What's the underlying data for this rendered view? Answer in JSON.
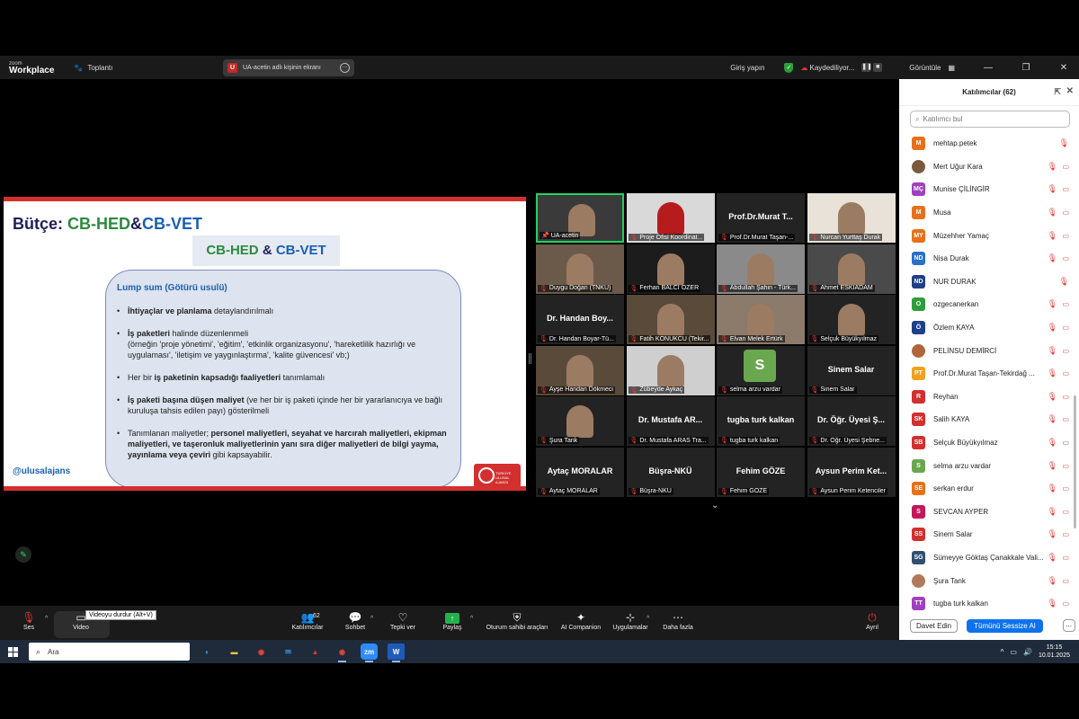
{
  "titlebar": {
    "brand_small": "zoom",
    "brand": "Workplace",
    "meeting_label": "Toplantı",
    "share_label": "UA-acetin adlı kişinin ekranı",
    "share_initial": "U",
    "signin": "Giriş yapın",
    "recording": "Kaydediliyor...",
    "view": "Görüntüle"
  },
  "slide": {
    "title_prefix": "Bütçe: ",
    "title_hed": "CB-HED",
    "title_amp": "&",
    "title_vet": "CB-VET",
    "banner_hed": "CB-HED",
    "banner_amp": " & ",
    "banner_vet": "CB-VET",
    "box_title": "Lump sum (Götürü usulü)",
    "b1_bold": "İhtiyaçlar ve planlama",
    "b1_rest": " detaylandırılmalı",
    "b2_bold": "İş paketleri",
    "b2_rest": " halinde düzenlenmeli",
    "b2_detail": "(örneğin 'proje yönetimi', 'eğitim', 'etkinlik organizasyonu', 'hareketlilik hazırlığı ve uygulaması', 'iletişim ve yaygınlaştırma', 'kalite güvencesi' vb;)",
    "b3_pre": "Her bir ",
    "b3_bold": "iş paketinin kapsadığı faaliyetleri",
    "b3_rest": " tanımlamalı",
    "b4_bold": "İş paketi başına düşen maliyet",
    "b4_rest": " (ve her bir iş paketi içinde her bir yararlanıcıya ve bağlı kuruluşa tahsis edilen payı) gösterilmeli",
    "b5_pre": "Tanımlanan maliyetler; ",
    "b5_bold": "personel maliyetleri, seyahat ve harcırah maliyetleri, ekipman maliyetleri, ve taşeronluk maliyetlerinin yanı sıra diğer maliyetleri de bilgi yayma, yayınlama veya çeviri",
    "b5_rest": " gibi kapsayabilir.",
    "tag": "@ulusalajans",
    "logo_text": "TÜRKİYE ULUSAL AJANSI"
  },
  "gallery": {
    "tiles": [
      {
        "label": "UA-acetin",
        "big": ""
      },
      {
        "label": "Proje Ofisi Koordinat...",
        "big": ""
      },
      {
        "label": "Prof.Dr.Murat Taşan-...",
        "big": "Prof.Dr.Murat T..."
      },
      {
        "label": "Nurcan Yurttaş Durak",
        "big": ""
      },
      {
        "label": "Duygu Doğan (TNKU)",
        "big": ""
      },
      {
        "label": "Ferhan BALCI ÖZER",
        "big": ""
      },
      {
        "label": "Abdullah Şahin - Türk...",
        "big": ""
      },
      {
        "label": "Ahmet ESKİADAM",
        "big": ""
      },
      {
        "label": "Dr. Handan Boyar-Tü...",
        "big": "Dr. Handan Boy..."
      },
      {
        "label": "Fatih KONUKCU (Tekir...",
        "big": ""
      },
      {
        "label": "Elvan Melek Ertürk",
        "big": ""
      },
      {
        "label": "Selçuk Büyükyılmaz",
        "big": ""
      },
      {
        "label": "Ayşe Handan Dökmeci",
        "big": ""
      },
      {
        "label": "Zübeyde Aykaç",
        "big": ""
      },
      {
        "label": "selma arzu vardar",
        "big": "S"
      },
      {
        "label": "Sinem Salar",
        "big": "Sinem Salar"
      },
      {
        "label": "Şura Tank",
        "big": ""
      },
      {
        "label": "Dr. Mustafa ARAS Tra...",
        "big": "Dr. Mustafa AR..."
      },
      {
        "label": "tugba turk kalkan",
        "big": "tugba turk kalkan"
      },
      {
        "label": "Dr. Öğr. Üyesi Şebne...",
        "big": "Dr. Öğr. Üyesi Ş..."
      },
      {
        "label": "Aytaç MORALAR",
        "big": "Aytaç MORALAR"
      },
      {
        "label": "Büşra-NKÜ",
        "big": "Büşra-NKÜ"
      },
      {
        "label": "Fehim GÖZE",
        "big": "Fehim GÖZE"
      },
      {
        "label": "Aysun Perim Ketenciler",
        "big": "Aysun Perim Ket..."
      }
    ]
  },
  "panel": {
    "title": "Katılımcılar (62)",
    "search_placeholder": "Katılımcı bul",
    "participants": [
      {
        "initials": "M",
        "name": "mehtap.petek",
        "color": "#e8701a",
        "cam": false
      },
      {
        "initials": "",
        "name": "Mert Uğur Kara",
        "color": "#7b5a3c",
        "cam": true
      },
      {
        "initials": "MÇ",
        "name": "Munise ÇİLİNGİR",
        "color": "#a040c0",
        "cam": true
      },
      {
        "initials": "M",
        "name": "Musa",
        "color": "#e8701a",
        "cam": true
      },
      {
        "initials": "MY",
        "name": "Müzehher Yamaç",
        "color": "#e8701a",
        "cam": true
      },
      {
        "initials": "ND",
        "name": "Nisa Durak",
        "color": "#2a6fc9",
        "cam": true
      },
      {
        "initials": "ND",
        "name": "NUR DURAK",
        "color": "#1e3f8a",
        "cam": false
      },
      {
        "initials": "O",
        "name": "ozgecanerkan",
        "color": "#2e9d3a",
        "cam": true
      },
      {
        "initials": "Ö",
        "name": "Özlem KAYA",
        "color": "#1e3f8a",
        "cam": true
      },
      {
        "initials": "",
        "name": "PELİNSU DEMİRCİ",
        "color": "#b0653a",
        "cam": true
      },
      {
        "initials": "PT",
        "name": "Prof.Dr.Murat Taşan-Tekirdağ ...",
        "color": "#f0a020",
        "cam": true
      },
      {
        "initials": "R",
        "name": "Reyhan",
        "color": "#d32f2f",
        "cam": true
      },
      {
        "initials": "SK",
        "name": "Salih KAYA",
        "color": "#d32f2f",
        "cam": true
      },
      {
        "initials": "SB",
        "name": "Selçuk Büyükyılmaz",
        "color": "#d32f2f",
        "cam": false,
        "mic_on": true
      },
      {
        "initials": "S",
        "name": "selma arzu vardar",
        "color": "#6aa84f",
        "cam": true
      },
      {
        "initials": "SE",
        "name": "serkan erdur",
        "color": "#e8701a",
        "cam": true
      },
      {
        "initials": "S",
        "name": "SEVCAN AYPER",
        "color": "#c2185b",
        "cam": true
      },
      {
        "initials": "SS",
        "name": "Sinem Salar",
        "color": "#d32f2f",
        "cam": true
      },
      {
        "initials": "SG",
        "name": "Sümeyye Göktaş Çanakkale Vali...",
        "color": "#2f4f6f",
        "cam": true
      },
      {
        "initials": "",
        "name": "Şura Tank",
        "color": "#b07a5a",
        "cam": true
      },
      {
        "initials": "TT",
        "name": "tugba turk kalkan",
        "color": "#a040c0",
        "cam": true
      }
    ],
    "invite": "Davet Edin",
    "mute_all": "Tümünü Sessize Al",
    "more": "..."
  },
  "toolbar": {
    "audio": "Ses",
    "video": "Video",
    "video_tooltip": "Videoyu durdur (Alt+V)",
    "participants": "Katılımcılar",
    "participants_count": "62",
    "chat": "Sohbet",
    "reactions": "Tepki ver",
    "share": "Paylaş",
    "host_tools": "Oturum sahibi araçları",
    "ai": "AI Companion",
    "apps": "Uygulamalar",
    "more": "Daha fazla",
    "leave": "Ayrıl"
  },
  "taskbar": {
    "search": "Ara",
    "time": "15:15",
    "date": "10.01.2025",
    "app_zoom": "zm",
    "app_word": "W"
  }
}
